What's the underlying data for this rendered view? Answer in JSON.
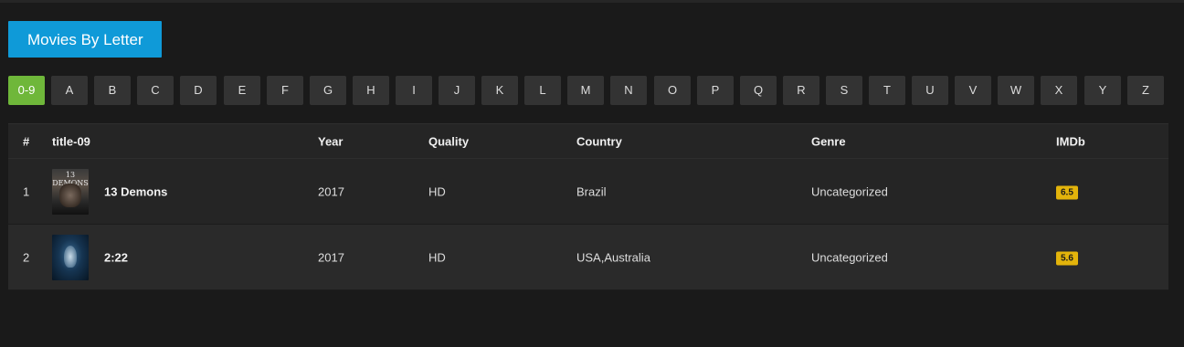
{
  "section_title": "Movies By Letter",
  "letters": [
    "0-9",
    "A",
    "B",
    "C",
    "D",
    "E",
    "F",
    "G",
    "H",
    "I",
    "J",
    "K",
    "L",
    "M",
    "N",
    "O",
    "P",
    "Q",
    "R",
    "S",
    "T",
    "U",
    "V",
    "W",
    "X",
    "Y",
    "Z"
  ],
  "active_letter": "0-9",
  "table": {
    "headers": {
      "num": "#",
      "title": "title-09",
      "year": "Year",
      "quality": "Quality",
      "country": "Country",
      "genre": "Genre",
      "imdb": "IMDb"
    },
    "rows": [
      {
        "num": "1",
        "title": "13 Demons",
        "poster_text": "13 DEMONS",
        "year": "2017",
        "quality": "HD",
        "country": "Brazil",
        "genre": "Uncategorized",
        "imdb": "6.5"
      },
      {
        "num": "2",
        "title": "2:22",
        "year": "2017",
        "quality": "HD",
        "country": "USA,Australia",
        "genre": "Uncategorized",
        "imdb": "5.6"
      }
    ]
  },
  "colors": {
    "background": "#1a1a1a",
    "accent_blue": "#0f9ad8",
    "active_green": "#6fb73a",
    "imdb_yellow": "#e3b40b"
  }
}
